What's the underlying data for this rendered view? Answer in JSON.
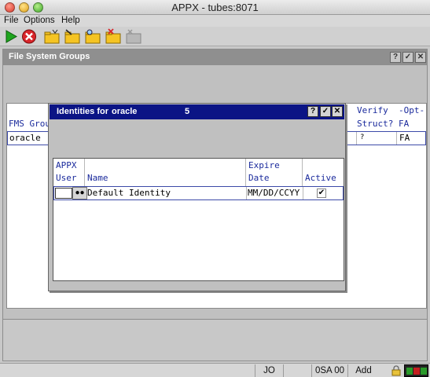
{
  "window": {
    "title": "APPX - tubes:8071"
  },
  "menu": [
    "File",
    "Options",
    "Help"
  ],
  "toolbar": {
    "icons": [
      "run-icon",
      "stop-icon",
      "folder-open-icon",
      "folder-edit-icon",
      "folder-search-icon",
      "folder-delete-icon",
      "disabled-folder-icon"
    ]
  },
  "main": {
    "title": "File System Groups",
    "header_buttons": [
      "?",
      "✓",
      "✕"
    ],
    "columns": {
      "fms_group": "FMS Grou",
      "verify_1": "Verify",
      "verify_2": "Struct?",
      "opt_1": "-Opt-",
      "opt_2": "FA"
    },
    "row": {
      "fms_group": "oracle",
      "verify": "?",
      "opt": "FA"
    }
  },
  "dialog": {
    "title_prefix": "Identities for",
    "title_name": "oracle",
    "title_count": "5",
    "buttons": [
      "?",
      "✓",
      "✕"
    ],
    "columns": {
      "user_1": "APPX",
      "user_2": "User",
      "name": "Name",
      "expire_1": "Expire",
      "expire_2": "Date",
      "active": "Active"
    },
    "row": {
      "user": "",
      "name": "Default Identity",
      "expire": "MM/DD/CCYY",
      "active_mark": "✔"
    }
  },
  "statusbar": {
    "user": "JO",
    "blank": "",
    "app": "0SA 00",
    "mode": "Add"
  }
}
